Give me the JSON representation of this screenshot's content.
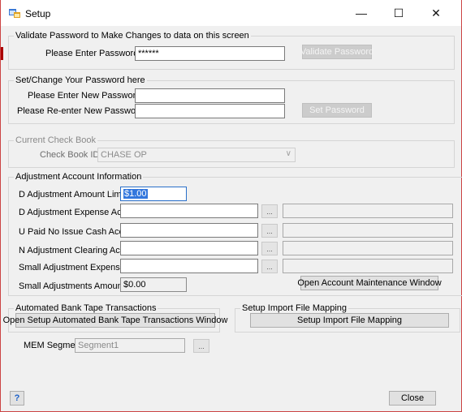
{
  "window": {
    "title": "Setup",
    "minimize_glyph": "—",
    "maximize_glyph": "☐",
    "close_glyph": "✕"
  },
  "validate": {
    "group_title": "Validate Password to Make Changes to data on this screen",
    "password_label": "Please Enter Password :",
    "password_value": "******",
    "validate_button": "Validate Password"
  },
  "set_password": {
    "group_title": "Set/Change Your Password here",
    "new_label": "Please Enter New Password :",
    "reenter_label": "Please Re-enter New Password :",
    "set_button": "Set Password"
  },
  "check_book": {
    "group_title": "Current Check Book",
    "id_label": "Check Book ID",
    "id_value": "CHASE OP"
  },
  "adjustment": {
    "group_title": "Adjustment Account Information",
    "amount_limit_label": "D Adjustment Amount Limit",
    "amount_limit_value": "$1.00",
    "expense_label": "D Adjustment Expense Account",
    "upaid_label": "U Paid No Issue Cash Account",
    "clearing_label": "N Adjustment Clearing Account",
    "small_expense_label": "Small Adjustment Expense",
    "small_limit_label": "Small Adjustments Amount Limit",
    "small_limit_value": "$0.00",
    "lookup_glyph": "...",
    "open_account_button": "Open Account Maintenance Window"
  },
  "bank_tape": {
    "group_title": "Automated Bank Tape Transactions",
    "open_button": "Open Setup Automated Bank Tape Transactions Window"
  },
  "import_mapping": {
    "group_title": "Setup Import File Mapping",
    "button": "Setup Import File Mapping"
  },
  "mem": {
    "label": "MEM Segment",
    "value": "Segment1",
    "lookup_glyph": "..."
  },
  "footer": {
    "help_glyph": "?",
    "close_button": "Close"
  }
}
